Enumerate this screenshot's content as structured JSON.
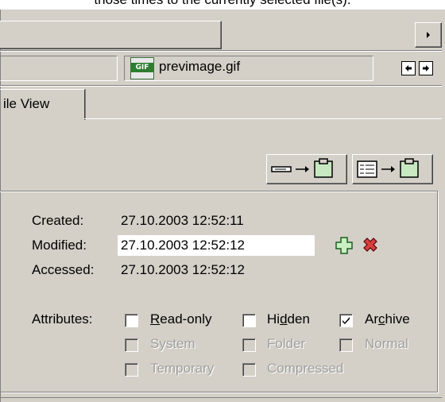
{
  "caption": "those times to the currently selected file(s).",
  "path": {
    "file_name": "previmage.gif",
    "file_icon_label": "GIF",
    "icons": [
      "gif-file-icon",
      "nav-back-icon",
      "nav-forward-icon",
      "scroll-right-arrow-icon"
    ]
  },
  "tab": {
    "label": "ile View"
  },
  "toolbar": {
    "copy_buttons": [
      "copy-field-to-clipboard-icon",
      "copy-list-to-clipboard-icon"
    ]
  },
  "times": {
    "created_label": "Created:",
    "created_value": "27.10.2003 12:52:11",
    "modified_label": "Modified:",
    "modified_value": "27.10.2003 12:52:12",
    "accessed_label": "Accessed:",
    "accessed_value": "27.10.2003 12:52:12",
    "icons": [
      "add-icon",
      "delete-icon"
    ]
  },
  "attributes": {
    "label": "Attributes:",
    "items": [
      {
        "label": "Read-only",
        "checked": false,
        "enabled": true
      },
      {
        "label": "Hidden",
        "checked": false,
        "enabled": true
      },
      {
        "label": "Archive",
        "checked": true,
        "enabled": true
      },
      {
        "label": "System",
        "checked": false,
        "enabled": false
      },
      {
        "label": "Folder",
        "checked": false,
        "enabled": false
      },
      {
        "label": "Normal",
        "checked": false,
        "enabled": false
      },
      {
        "label": "Temporary",
        "checked": false,
        "enabled": false
      },
      {
        "label": "Compressed",
        "checked": false,
        "enabled": false
      }
    ]
  },
  "colors": {
    "window_bg": "#d4d0c8",
    "shadow": "#808080",
    "disabled_text": "#a0a0a0",
    "add_icon": "#2e7d32",
    "delete_icon": "#b22222"
  }
}
